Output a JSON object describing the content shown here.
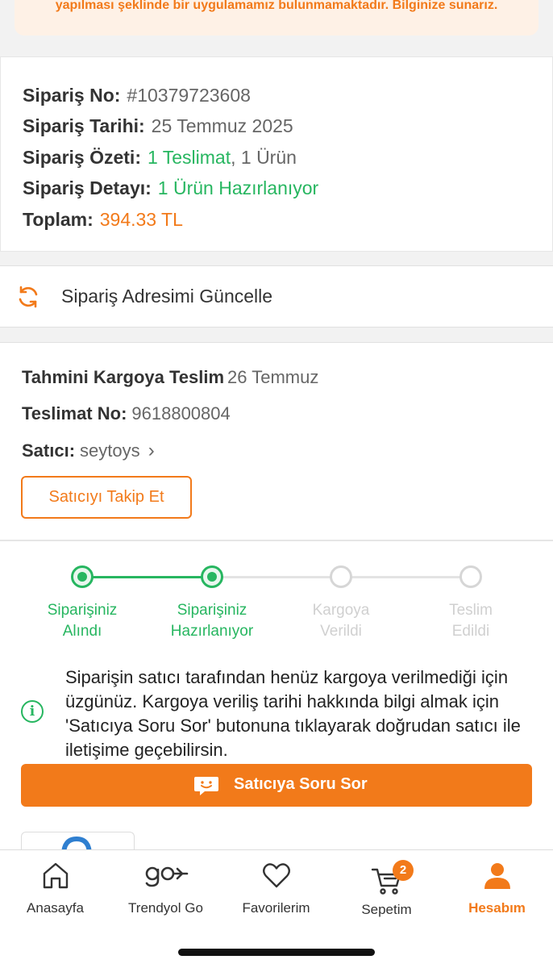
{
  "notice": {
    "text": "yapılması şeklinde bir uygulamamız bulunmamaktadır. Bilginize sunarız."
  },
  "order": {
    "order_no_label": "Sipariş No:",
    "order_no": "#10379723608",
    "date_label": "Sipariş Tarihi:",
    "date": "25 Temmuz 2025",
    "summary_label": "Sipariş Özeti:",
    "summary_delivery": "1 Teslimat",
    "summary_sep": ",",
    "summary_items": " 1 Ürün",
    "detail_label": "Sipariş Detayı:",
    "detail": "1 Ürün Hazırlanıyor",
    "total_label": "Toplam:",
    "total": "394.33 TL"
  },
  "address": {
    "label": "Sipariş Adresimi Güncelle",
    "icon": "refresh-icon"
  },
  "shipment": {
    "estimate_label": "Tahmini Kargoya Teslim",
    "estimate_value": "26 Temmuz",
    "delivery_no_label": "Teslimat No:",
    "delivery_no": "9618800804",
    "seller_label": "Satıcı:",
    "seller": "seytoys",
    "seller_chevron": "›",
    "follow_button": "Satıcıyı Takip Et"
  },
  "tracker": {
    "steps": [
      {
        "line1": "Siparişiniz",
        "line2": "Alındı",
        "done": true
      },
      {
        "line1": "Siparişiniz",
        "line2": "Hazırlanıyor",
        "done": true
      },
      {
        "line1": "Kargoya",
        "line2": "Verildi",
        "done": false
      },
      {
        "line1": "Teslim",
        "line2": "Edildi",
        "done": false
      }
    ],
    "active_color": "#27b660",
    "inactive_color": "#d6d6d6"
  },
  "info": {
    "icon": "info-icon",
    "text": "Siparişin satıcı tarafından henüz kargoya verilmediği için üzgünüz. Kargoya veriliş tarihi hakkında bilgi almak için 'Satıcıya Soru Sor' butonuna tıklayarak doğrudan satıcı ile iletişime geçebilirsin."
  },
  "ask_button": {
    "label": "Satıcıya Soru Sor",
    "icon": "chat-smile-icon"
  },
  "tabbar": {
    "items": [
      {
        "label": "Anasayfa",
        "icon": "home-icon"
      },
      {
        "label": "Trendyol Go",
        "icon": "trendyol-go-icon"
      },
      {
        "label": "Favorilerim",
        "icon": "heart-icon"
      },
      {
        "label": "Sepetim",
        "icon": "cart-icon",
        "badge": "2"
      },
      {
        "label": "Hesabım",
        "icon": "user-icon",
        "active": true
      }
    ]
  },
  "colors": {
    "brand": "#f27a1a",
    "success": "#27b660"
  }
}
